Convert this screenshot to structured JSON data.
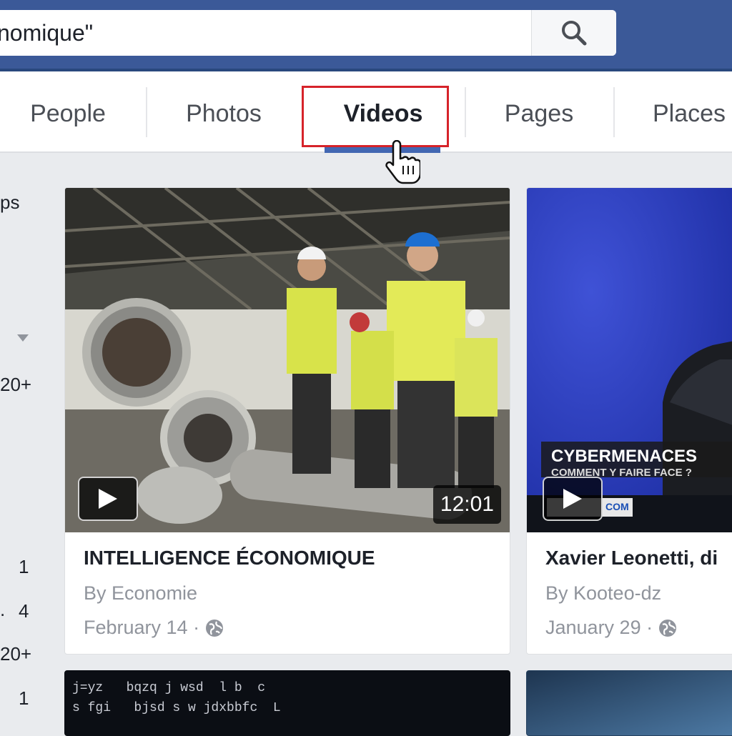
{
  "search": {
    "value": "nomique\""
  },
  "tabs": [
    {
      "label": "People"
    },
    {
      "label": "Photos"
    },
    {
      "label": "Videos"
    },
    {
      "label": "Pages"
    },
    {
      "label": "Places"
    }
  ],
  "sidebar": {
    "fragments": [
      "ps",
      "20+",
      "1",
      "4",
      "20+",
      "1"
    ]
  },
  "videos": [
    {
      "title": "INTELLIGENCE ÉCONOMIQUE",
      "by": "By Economie",
      "date": "February 14 ·",
      "duration": "12:01"
    },
    {
      "title": "Xavier Leonetti, di",
      "by": "By Kooteo-dz",
      "date": "January 29 ·",
      "overlay_headline": "CYBERMENACES",
      "overlay_subline": "COMMENT Y FAIRE FACE ?",
      "overlay_source": "COM"
    }
  ],
  "bottom_thumb_text": {
    "line1": "j=yz   bqzq j wsd  l b  c",
    "line2": "s fgi   bjsd s w jdxbbfc  L"
  },
  "colors": {
    "brand": "#3b5998",
    "highlight": "#d6232a",
    "active_underline": "#4267b2"
  }
}
